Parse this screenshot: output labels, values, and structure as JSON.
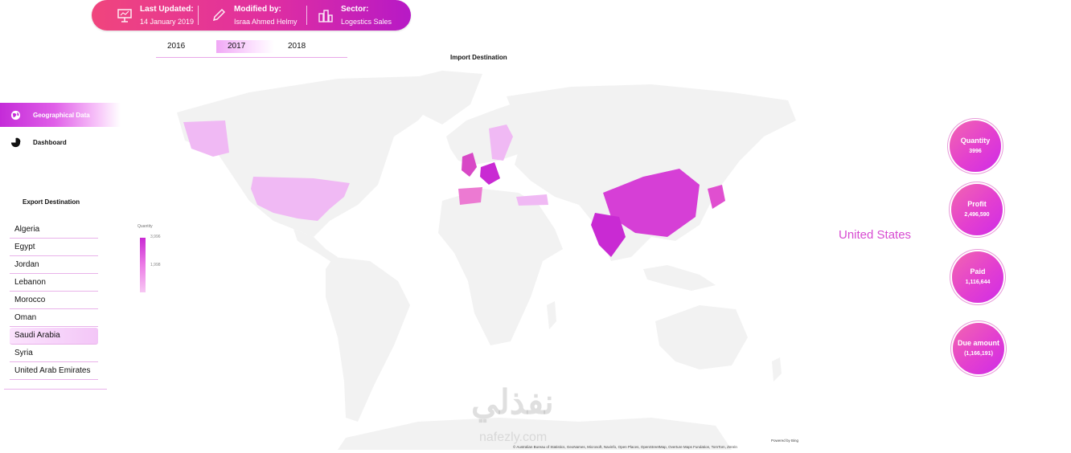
{
  "header": {
    "last_updated_label": "Last Updated:",
    "last_updated_value": "14 January 2019",
    "modified_by_label": "Modified by:",
    "modified_by_value": "Israa Ahmed Helmy",
    "sector_label": "Sector:",
    "sector_value": "Logestics Sales"
  },
  "years": [
    "2016",
    "2017",
    "2018"
  ],
  "active_year": "2017",
  "map": {
    "title": "Import Destination",
    "legend_title": "Quantity",
    "legend_max": "3,996",
    "legend_mid": "1,998",
    "credit_powered": "Powered by Bing",
    "credit_sources": "© Australian Bureau of Statistics, GeoNames, Microsoft, Navinfo, Open Places, OpenStreetMap, Overture Maps Fundation, TomTom, Zenrin"
  },
  "nav": {
    "items": [
      {
        "label": "Geographical Data",
        "icon": "globe-icon",
        "active": true
      },
      {
        "label": "Dashboard",
        "icon": "pie-chart-icon",
        "active": false
      }
    ]
  },
  "export": {
    "title": "Export Destination",
    "items": [
      "Algeria",
      "Egypt",
      "Jordan",
      "Lebanon",
      "Morocco",
      "Oman",
      "Saudi Arabia",
      "Syria",
      "United Arab Emirates"
    ],
    "selected": "Saudi Arabia"
  },
  "kpis": {
    "quantity_label": "Quantity",
    "quantity_value": "3996",
    "profit_label": "Profit",
    "profit_value": "2,496,590",
    "paid_label": "Paid",
    "paid_value": "1,116,644",
    "due_label": "Due amount",
    "due_value": "(1,166,191)"
  },
  "selected_country": "United States",
  "watermark": {
    "text": "نفذلي",
    "sub": "nafezly.com"
  },
  "colors": {
    "accent": "#d74bd1",
    "pink": "#f0457d",
    "purple": "#b719c6",
    "land": "#f2f2f2"
  }
}
